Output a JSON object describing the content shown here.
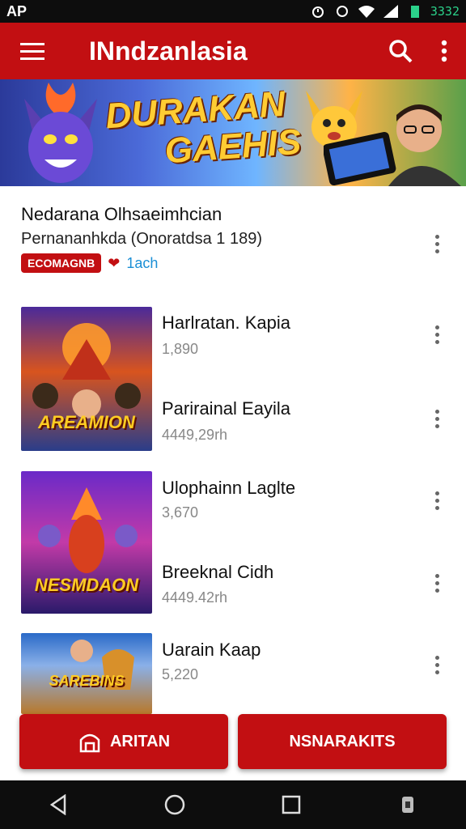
{
  "status": {
    "left": "AP",
    "time": "3332"
  },
  "app": {
    "title": "INndzanlasia"
  },
  "banner": {
    "line1": "DURAKAN",
    "line2": "GAEHIS"
  },
  "featured": {
    "title": "Nedarana Olhsaeimhcian",
    "subtitle": "Pernananhkda (Onoratdsa 1 189)",
    "tag": "ECOMAGNB",
    "link": "1ach"
  },
  "items": [
    {
      "title": "Harlratan. Kapia",
      "sub": "1,890"
    },
    {
      "title": "Parirainal Eayila",
      "sub": "4449,29rh"
    },
    {
      "title": "Ulophainn Laglte",
      "sub": "3,670"
    },
    {
      "title": "Breeknal Cidh",
      "sub": "4449.42rh"
    },
    {
      "title": "Uarain Kaap",
      "sub": "5,220"
    }
  ],
  "thumbs": [
    {
      "caption": "AREAMION"
    },
    {
      "caption": "NESMDAON"
    },
    {
      "caption": "SAREBINS"
    }
  ],
  "buttons": {
    "left": "ARITAN",
    "right": "NSNARAKITS"
  },
  "colors": {
    "primary": "#c20f12",
    "accent_link": "#1a8fd6",
    "status_time": "#2bd18a"
  },
  "icons": [
    "menu-icon",
    "search-icon",
    "more-vert-icon",
    "back-icon",
    "home-icon",
    "recents-icon",
    "heart-icon",
    "store-icon"
  ]
}
